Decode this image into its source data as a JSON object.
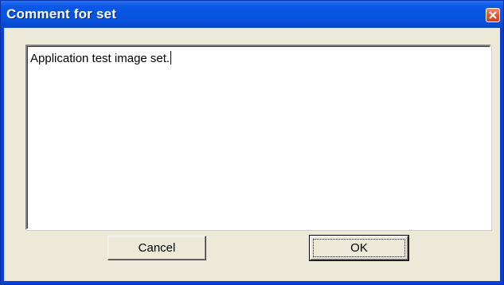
{
  "window": {
    "title": "Comment for set",
    "close_icon": "close-icon"
  },
  "comment": {
    "value": "Application test image set."
  },
  "buttons": {
    "cancel_label": "Cancel",
    "ok_label": "OK"
  },
  "colors": {
    "titlebar": "#0a58e6",
    "dialog_face": "#ece9d8",
    "close_button": "#e05a33"
  }
}
